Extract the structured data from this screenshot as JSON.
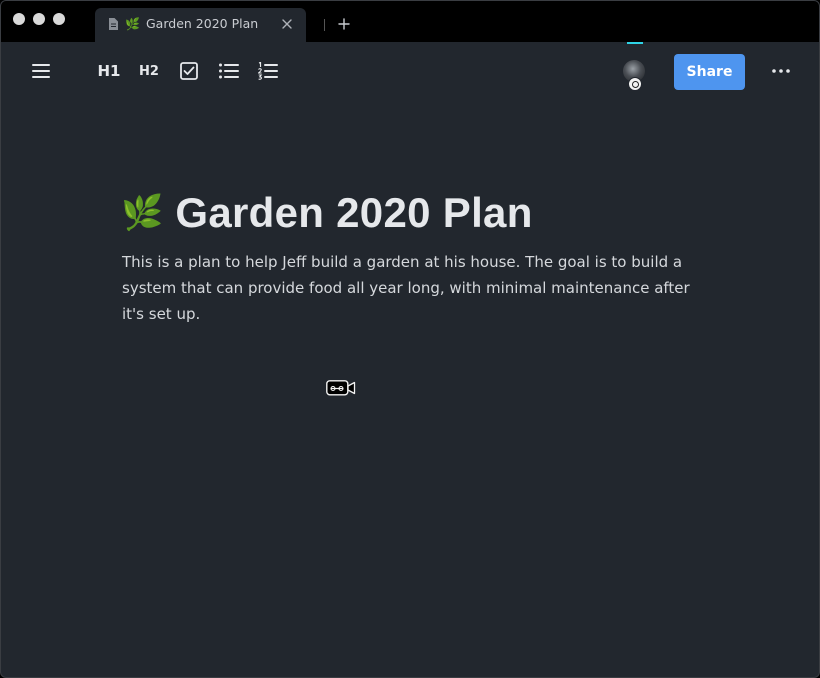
{
  "tab": {
    "title": "Garden 2020 Plan",
    "emoji": "🌿"
  },
  "toolbar": {
    "h1_label": "H1",
    "h2_label": "H2",
    "share_label": "Share"
  },
  "document": {
    "emoji": "🌿",
    "title": "Garden 2020 Plan",
    "body": "This is a plan to help Jeff build a garden at his house. The goal is to build a system that can provide food all year long, with minimal maintenance after it's set up."
  },
  "icons": {
    "tab_doc": "document-icon",
    "tab_close": "close-icon",
    "tab_add": "plus-icon",
    "menu": "hamburger-menu-icon",
    "checkbox": "checkbox-icon",
    "bullet_list": "bulleted-list-icon",
    "numbered_list": "numbered-list-icon",
    "more": "more-horizontal-icon",
    "video": "video-camera-icon"
  },
  "colors": {
    "background": "#22272e",
    "titlebar": "#000000",
    "accent": "#4e95ef",
    "active_indicator": "#2fd3e6",
    "text": "#e6e8eb"
  }
}
